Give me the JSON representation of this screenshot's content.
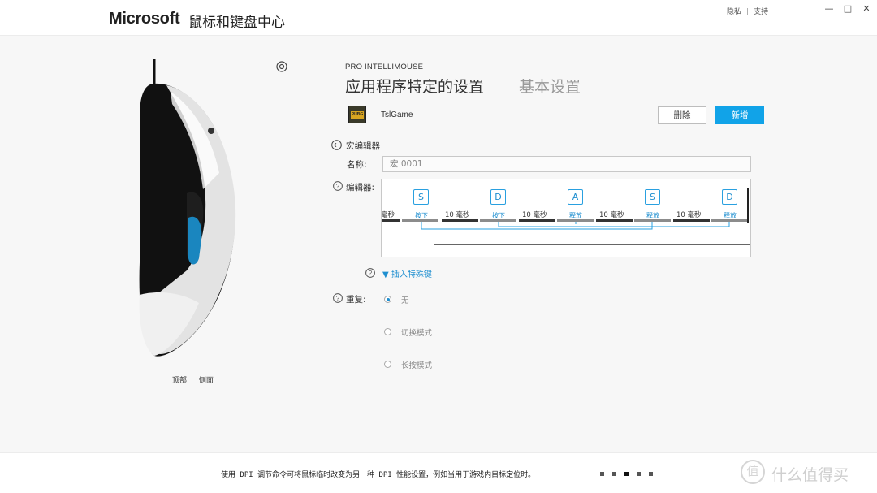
{
  "header": {
    "brand": "Microsoft",
    "app_title": "鼠标和键盘中心",
    "links": [
      "隐私",
      "支持"
    ],
    "link_separator": "|",
    "window_controls": [
      "—",
      "□",
      "✕"
    ]
  },
  "left_panel": {
    "views": [
      "顶部",
      "侧面"
    ],
    "icons": {
      "view_toggle": "view-toggle-icon",
      "mouse": "mouse-image"
    }
  },
  "main": {
    "product_name": "PRO INTELLIMOUSE",
    "tabs": [
      {
        "label": "应用程序特定的设置",
        "active": true
      },
      {
        "label": "基本设置",
        "active": false
      }
    ],
    "app": {
      "icon_text": "PUBG",
      "name": "TslGame"
    },
    "buttons": {
      "delete": "删除",
      "add": "新增"
    },
    "accent_color": "#11a3e8",
    "macro_editor": {
      "title": "宏编辑器",
      "name_label": "名称:",
      "name_value": "宏 0001",
      "editor_label": "编辑器:",
      "delay_partial": "毫秒",
      "sequence": [
        {
          "key": "S",
          "action": "按下"
        },
        {
          "delay": "10 毫秒"
        },
        {
          "key": "D",
          "action": "按下"
        },
        {
          "delay": "10 毫秒"
        },
        {
          "key": "A",
          "action": "释放"
        },
        {
          "delay": "10 毫秒"
        },
        {
          "key": "S",
          "action": "释放"
        },
        {
          "delay": "10 毫秒"
        },
        {
          "key": "D",
          "action": "释放"
        }
      ],
      "insert_special": "▼ 插入特殊键"
    },
    "repeat": {
      "label": "重复:",
      "options": [
        {
          "label": "无",
          "selected": true
        },
        {
          "label": "切换模式",
          "selected": false
        },
        {
          "label": "长按模式",
          "selected": false
        }
      ]
    }
  },
  "footer": {
    "tip": "使用 DPI 调节命令可将鼠标临时改变为另一种 DPI 性能设置，例如当用于游戏内目标定位时。",
    "pages": 5,
    "current_page": 3,
    "watermark_icon": "值",
    "watermark": "什么值得买"
  }
}
